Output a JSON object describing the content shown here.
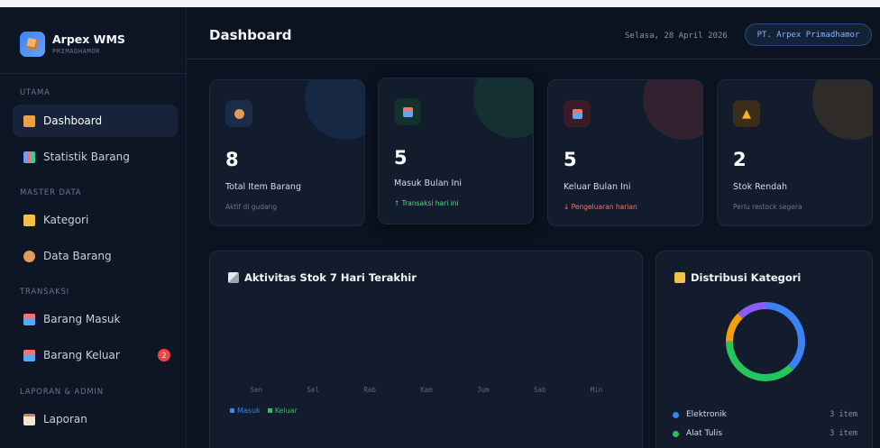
{
  "brand": {
    "name": "Arpex WMS",
    "subtitle": "PRIMADHAMOR"
  },
  "sidebar": {
    "sections": [
      "UTAMA",
      "MASTER DATA",
      "TRANSAKSI",
      "LAPORAN & ADMIN"
    ],
    "items": [
      {
        "label": "Dashboard",
        "icon": "house-icon",
        "active": true
      },
      {
        "label": "Statistik Barang",
        "icon": "bar-chart-icon"
      },
      {
        "label": "Kategori",
        "icon": "folder-icon"
      },
      {
        "label": "Data Barang",
        "icon": "box-icon"
      },
      {
        "label": "Barang Masuk",
        "icon": "inbox-in-icon"
      },
      {
        "label": "Barang Keluar",
        "icon": "inbox-out-icon",
        "badge": "2"
      },
      {
        "label": "Laporan",
        "icon": "clipboard-icon"
      }
    ]
  },
  "header": {
    "title": "Dashboard",
    "date": "Selasa, 28 April 2026",
    "company": "PT. Arpex Primadhamor"
  },
  "stats": [
    {
      "value": "8",
      "label": "Total Item Barang",
      "sub": "Aktif di gudang",
      "icon": "box-icon",
      "accent": "#3b82f6"
    },
    {
      "value": "5",
      "label": "Masuk Bulan Ini",
      "sub": "↑ Transaksi hari ini",
      "icon": "inbox-in-icon",
      "accent": "#22c55e"
    },
    {
      "value": "5",
      "label": "Keluar Bulan Ini",
      "sub": "↓ Pengeluaran harian",
      "icon": "inbox-out-icon",
      "accent": "#ef4444"
    },
    {
      "value": "2",
      "label": "Stok Rendah",
      "sub": "Perlu restock segera",
      "icon": "warning-icon",
      "accent": "#f59e0b"
    }
  ],
  "activity": {
    "title": "Aktivitas Stok 7 Hari Terakhir",
    "days": [
      "Sen",
      "Sel",
      "Rab",
      "Kam",
      "Jum",
      "Sab",
      "Min"
    ],
    "legend": [
      {
        "label": "Masuk",
        "color": "#3b82f6"
      },
      {
        "label": "Keluar",
        "color": "#22c55e"
      }
    ]
  },
  "distribution": {
    "title": "Distribusi Kategori",
    "categories": [
      {
        "name": "Elektronik",
        "count": "3 item",
        "color": "#3b82f6"
      },
      {
        "name": "Alat Tulis",
        "count": "3 item",
        "color": "#22c55e"
      }
    ]
  },
  "chart_data": {
    "type": "pie",
    "title": "Distribusi Kategori",
    "series": [
      {
        "name": "Elektronik",
        "value": 3,
        "color": "#3b82f6"
      },
      {
        "name": "Alat Tulis",
        "value": 3,
        "color": "#22c55e"
      },
      {
        "value": 1,
        "color": "#f59e0b"
      },
      {
        "value": 1,
        "color": "#8b5cf6"
      }
    ]
  },
  "colors": {
    "accent": "#3b82f6",
    "background": "#0b1220",
    "card": "#131c2d",
    "danger": "#ef4444"
  }
}
